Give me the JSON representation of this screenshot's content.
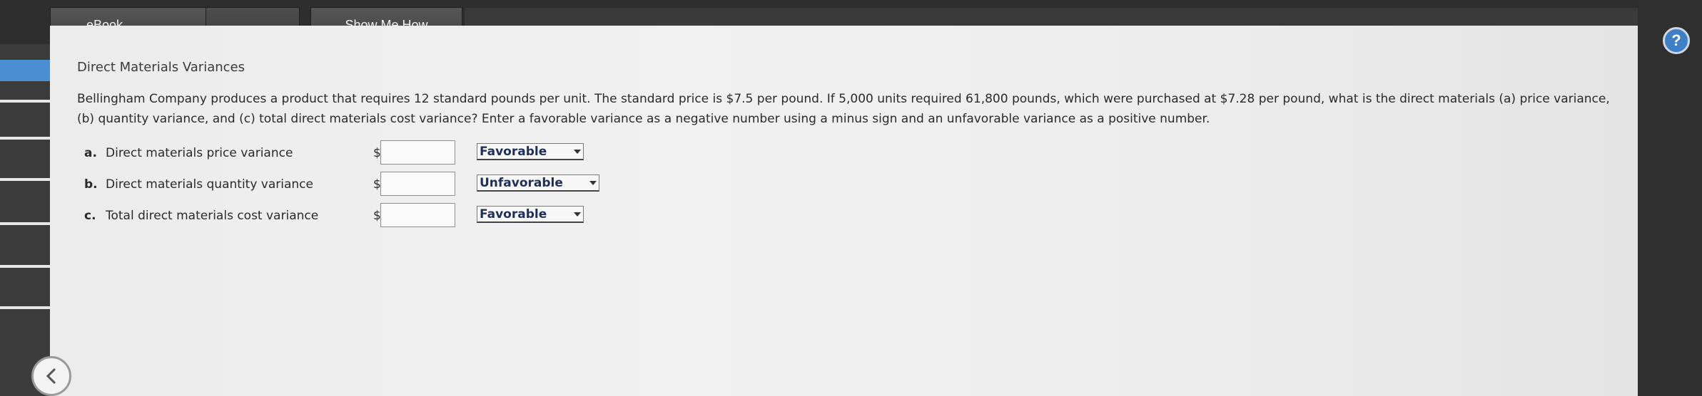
{
  "tabs": {
    "ebook": "eBook",
    "show_me_how": "Show Me How"
  },
  "section_title": "Direct Materials Variances",
  "question": "Bellingham Company produces a product that requires 12 standard pounds per unit. The standard price is $7.5 per pound. If 5,000 units required 61,800 pounds, which were purchased at $7.28 per pound, what is the direct materials (a) price variance, (b) quantity variance, and (c) total direct materials cost variance? Enter a favorable variance as a negative number using a minus sign and an unfavorable variance as a positive number.",
  "rows": [
    {
      "letter": "a.",
      "label": "Direct materials price variance",
      "currency": "$",
      "value": "",
      "selection": "Favorable"
    },
    {
      "letter": "b.",
      "label": "Direct materials quantity variance",
      "currency": "$",
      "value": "",
      "selection": "Unfavorable"
    },
    {
      "letter": "c.",
      "label": "Total direct materials cost variance",
      "currency": "$",
      "value": "",
      "selection": "Favorable"
    }
  ],
  "icons": {
    "help": "help-icon",
    "back": "chevron-left-icon"
  },
  "colors": {
    "accent": "#3f7fc5",
    "select_text": "#1e2f5a"
  }
}
